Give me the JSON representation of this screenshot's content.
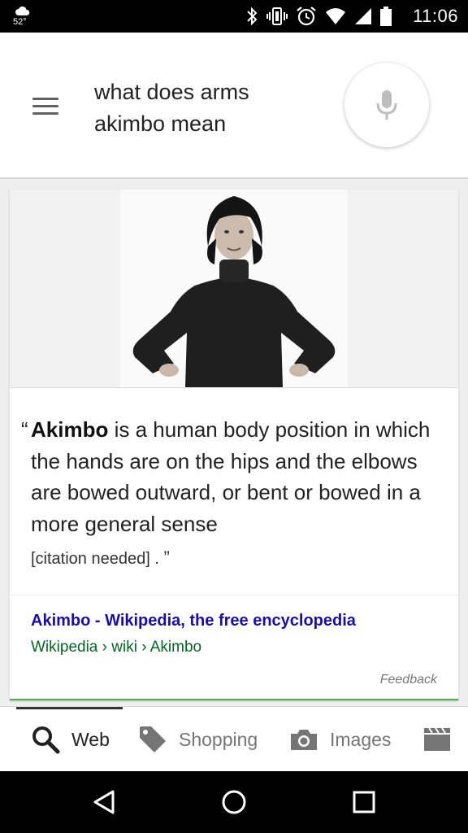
{
  "status_bar": {
    "temperature": "52°",
    "time": "11:06"
  },
  "search": {
    "query_line1": "what does arms",
    "query_line2": "akimbo mean"
  },
  "answer": {
    "open_quote": "“",
    "term": "Akimbo",
    "definition": " is a human body position in which the hands are on the hips and the elbows are bowed outward, or bent or bowed in a more general sense",
    "citation": "[citation needed]",
    "close_quote": "”",
    "source_title": "Akimbo - Wikipedia, the free encyclopedia",
    "source_url": "Wikipedia › wiki › Akimbo",
    "feedback": "Feedback"
  },
  "tabs": [
    {
      "label": "Web",
      "icon": "search-icon",
      "active": true
    },
    {
      "label": "Shopping",
      "icon": "tag-icon",
      "active": false
    },
    {
      "label": "Images",
      "icon": "camera-icon",
      "active": false
    },
    {
      "label": "",
      "icon": "video-icon",
      "active": false
    }
  ],
  "colors": {
    "link": "#1a0dab",
    "url": "#006621",
    "accent_line": "#4caf50"
  }
}
